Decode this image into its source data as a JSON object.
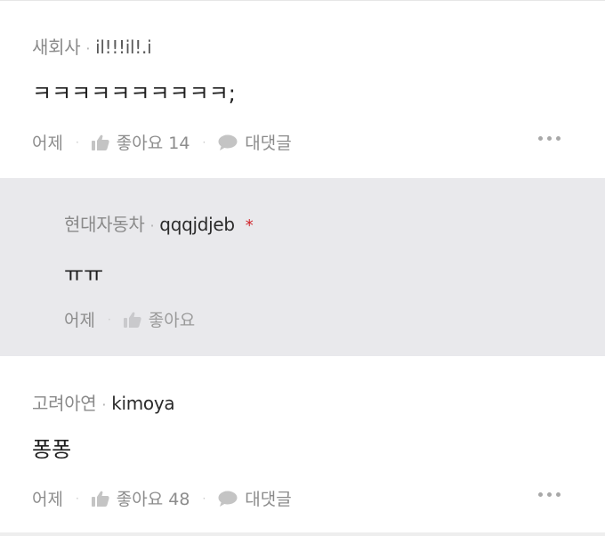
{
  "comments": [
    {
      "company": "새회사",
      "nickname": "il!!!il!.i",
      "text": "ㅋㅋㅋㅋㅋㅋㅋㅋㅋㅋ;",
      "time": "어제",
      "like_label": "좋아요 14",
      "reply_label": "대댓글"
    },
    {
      "company": "현대자동차",
      "nickname": "qqqjdjeb",
      "badge": "*",
      "text": "ㅠㅠ",
      "time": "어제",
      "like_label": "좋아요"
    },
    {
      "company": "고려아연",
      "nickname": "kimoya",
      "text": "퐁퐁",
      "time": "어제",
      "like_label": "좋아요 48",
      "reply_label": "대댓글"
    }
  ],
  "separator": "·",
  "icons": {
    "like": "thumbs-up-icon",
    "reply": "speech-bubble-icon",
    "more": "more-dots-icon"
  },
  "colors": {
    "reply_background": "#e9e9ec",
    "badge": "#d0232a",
    "muted_text": "#8c8c8c"
  }
}
